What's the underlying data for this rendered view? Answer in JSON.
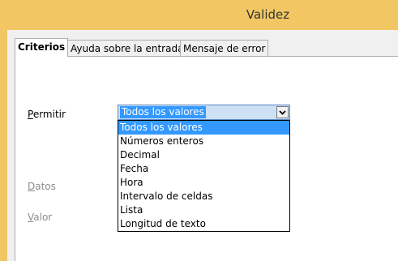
{
  "window": {
    "title": "Validez"
  },
  "tabs": [
    {
      "label": "Criterios"
    },
    {
      "label": "Ayuda sobre la entrada"
    },
    {
      "label": "Mensaje de error"
    }
  ],
  "form": {
    "permitir": {
      "accel": "P",
      "rest": "ermitir"
    },
    "datos": {
      "accel": "D",
      "rest": "atos"
    },
    "valor": {
      "accel": "V",
      "rest": "alor"
    },
    "selected_value": "Todos los valores"
  },
  "dropdown": {
    "options": [
      "Todos los valores",
      "Números enteros",
      "Decimal",
      "Fecha",
      "Hora",
      "Intervalo de celdas",
      "Lista",
      "Longitud de texto"
    ]
  }
}
